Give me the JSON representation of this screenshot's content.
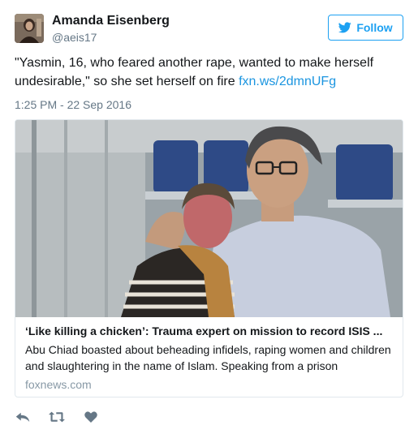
{
  "user": {
    "name": "Amanda Eisenberg",
    "handle": "@aeis17"
  },
  "follow_label": "Follow",
  "tweet": {
    "text": "\"Yasmin, 16, who feared another rape, wanted to make herself undesirable,\" so she set herself on fire ",
    "link": "fxn.ws/2dmnUFg",
    "timestamp": "1:25 PM - 22 Sep 2016"
  },
  "card": {
    "title": "‘Like killing a chicken’: Trauma expert on mission to record ISIS ...",
    "description": "Abu Chiad boasted about beheading infidels, raping women and children and slaughtering in the name of Islam. Speaking from a prison",
    "domain": "foxnews.com"
  },
  "colors": {
    "accent": "#1da1f2",
    "link": "#1b95e0",
    "muted": "#657786"
  },
  "icons": [
    "twitter-bird-icon",
    "reply-icon",
    "retweet-icon",
    "like-icon"
  ]
}
